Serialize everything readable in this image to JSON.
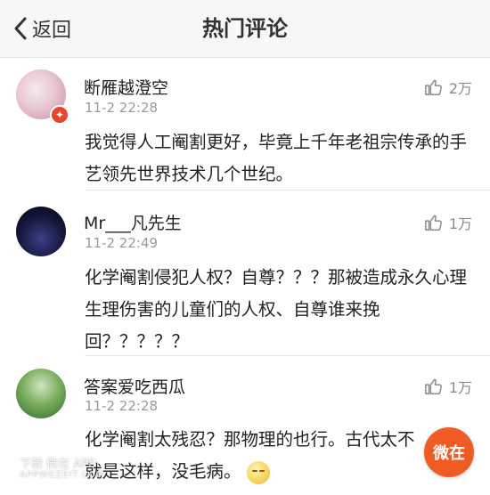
{
  "header": {
    "back_label": "返回",
    "title": "热门评论"
  },
  "comments": [
    {
      "name": "断雁越澄空",
      "time": "11-2 22:28",
      "likes": "2万",
      "text": "我觉得人工阉割更好，毕竟上千年老祖宗传承的手艺领先世界技术几个世纪。"
    },
    {
      "name": "Mr___凡先生",
      "time": "11-2 22:49",
      "likes": "1万",
      "text": "化学阉割侵犯人权？自尊？？？那被造成永久心理生理伤害的儿童们的人权、自尊谁来挽回？？？？？"
    },
    {
      "name": "答案爱吃西瓜",
      "time": "11-2 22:28",
      "likes": "1万",
      "text": "化学阉割太残忍？那物理的也行。古代太不就是这样，没毛病。"
    }
  ],
  "fab_label": "微在",
  "watermark": {
    "line1": "下载 微在 APP",
    "line2": "APPWEZEIT.COM"
  },
  "icons": {
    "back": "chevron-left-icon",
    "like": "thumbs-up-icon",
    "emoji": "emoji-icon"
  },
  "colors": {
    "accent": "#f05a24",
    "muted": "#9a9a9a"
  }
}
